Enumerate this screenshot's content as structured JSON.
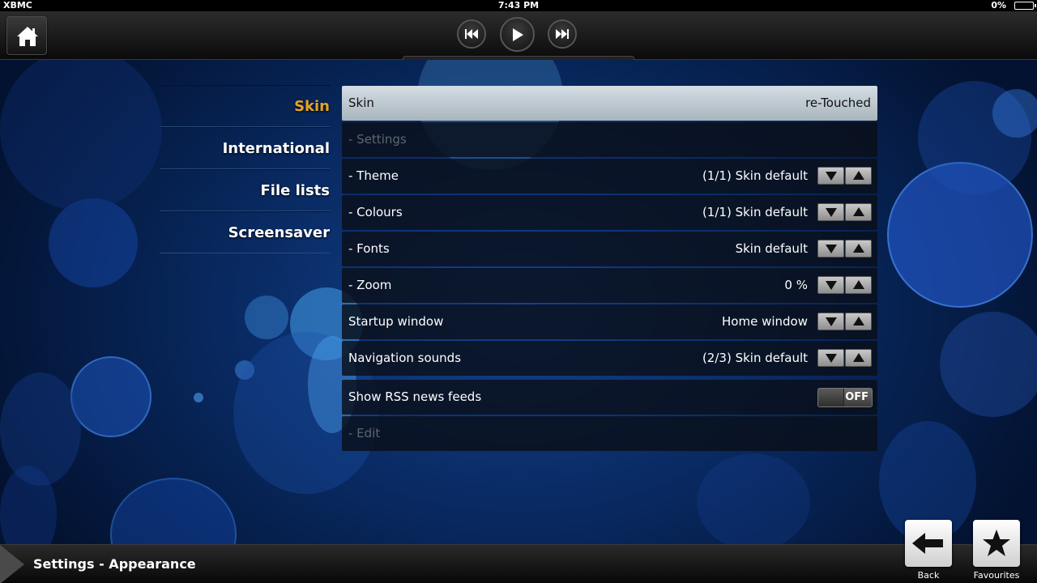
{
  "status_bar": {
    "carrier": "XBMC",
    "time": "7:43 PM",
    "battery": "0%"
  },
  "top_bar": {
    "home_icon": "home-icon",
    "controls": [
      "previous-icon",
      "play-icon",
      "next-icon"
    ]
  },
  "nav": {
    "items": [
      {
        "label": "Skin",
        "active": true
      },
      {
        "label": "International",
        "active": false
      },
      {
        "label": "File lists",
        "active": false
      },
      {
        "label": "Screensaver",
        "active": false
      }
    ]
  },
  "settings": {
    "skin": {
      "label": "Skin",
      "value": "re-Touched"
    },
    "settings_header": {
      "label": "- Settings"
    },
    "theme": {
      "label": "- Theme",
      "value": "(1/1) Skin default"
    },
    "colours": {
      "label": "- Colours",
      "value": "(1/1) Skin default"
    },
    "fonts": {
      "label": "- Fonts",
      "value": "Skin default"
    },
    "zoom": {
      "label": "- Zoom",
      "value": "0 %"
    },
    "startup_window": {
      "label": "Startup window",
      "value": "Home window"
    },
    "navigation_sounds": {
      "label": "Navigation sounds",
      "value": "(2/3) Skin default"
    },
    "rss": {
      "label": "Show RSS news feeds",
      "toggle": "OFF"
    },
    "edit": {
      "label": "- Edit"
    }
  },
  "footer": {
    "title": "Settings - Appearance",
    "back_label": "Back",
    "favourites_label": "Favourites"
  },
  "colors": {
    "accent": "#e6a326",
    "focused_row": "#c3ced5",
    "row_bg": "#0a0f19"
  }
}
